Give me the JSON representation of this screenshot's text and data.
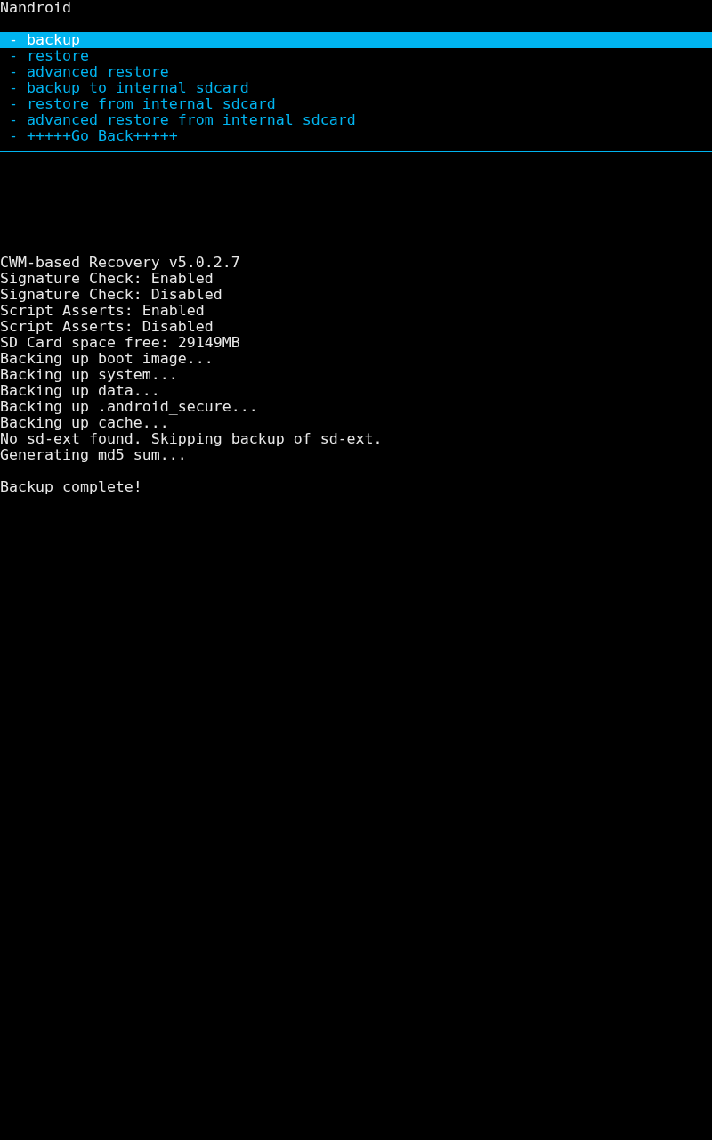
{
  "header": {
    "title": "Nandroid"
  },
  "menu": {
    "items": [
      {
        "label": "- backup",
        "selected": true
      },
      {
        "label": "- restore",
        "selected": false
      },
      {
        "label": "- advanced restore",
        "selected": false
      },
      {
        "label": "- backup to internal sdcard",
        "selected": false
      },
      {
        "label": "- restore from internal sdcard",
        "selected": false
      },
      {
        "label": "- advanced restore from internal sdcard",
        "selected": false
      },
      {
        "label": "- +++++Go Back+++++",
        "selected": false
      }
    ]
  },
  "log": {
    "lines": [
      "CWM-based Recovery v5.0.2.7",
      "Signature Check: Enabled",
      "Signature Check: Disabled",
      "Script Asserts: Enabled",
      "Script Asserts: Disabled",
      "SD Card space free: 29149MB",
      "Backing up boot image...",
      "Backing up system...",
      "Backing up data...",
      "Backing up .android_secure...",
      "Backing up cache...",
      "No sd-ext found. Skipping backup of sd-ext.",
      "Generating md5 sum..."
    ],
    "result": "Backup complete!"
  }
}
